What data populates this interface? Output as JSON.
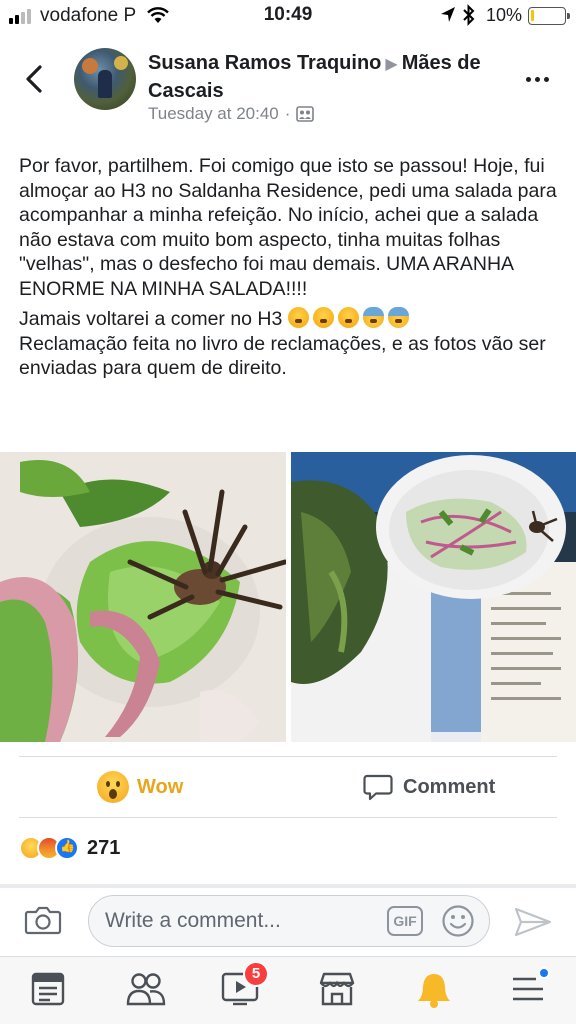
{
  "status_bar": {
    "carrier": "vodafone P",
    "time": "10:49",
    "battery_percent": "10%",
    "battery_level": 0.1
  },
  "post": {
    "author": "Susana Ramos Traquino",
    "group": "Mães de Cascais",
    "timestamp": "Tuesday at 20:40",
    "separator": "·",
    "text_paragraphs": [
      "Por favor, partilhem. Foi comigo que isto se passou! Hoje, fui almoçar ao H3 no Saldanha Residence, pedi uma salada para acompanhar a minha refeição. No início, achei que a salada não estava com muito bom aspecto, tinha muitas folhas \"velhas\", mas o desfecho foi mau demais. UMA ARANHA ENORME NA MINHA SALADA!!!!",
      "Jamais voltarei a comer no H3",
      "Reclamação feita no livro de reclamações, e as fotos vão ser enviadas para quem de direito."
    ],
    "emojis": [
      "angry-face",
      "angry-face",
      "angry-face",
      "fearful-face",
      "fearful-face"
    ],
    "photos": [
      "salad-with-spider-closeup",
      "salad-bowl-and-receipt"
    ]
  },
  "actions": {
    "wow_label": "Wow",
    "comment_label": "Comment",
    "wow_color": "#e9a51c"
  },
  "summary": {
    "reactions": [
      "wow",
      "angry",
      "like"
    ],
    "count": "271"
  },
  "composer": {
    "placeholder": "Write a comment...",
    "gif_label": "GIF"
  },
  "tabbar": {
    "items": [
      "news-feed",
      "friends",
      "watch",
      "marketplace",
      "notifications",
      "menu"
    ],
    "watch_badge": "5"
  }
}
